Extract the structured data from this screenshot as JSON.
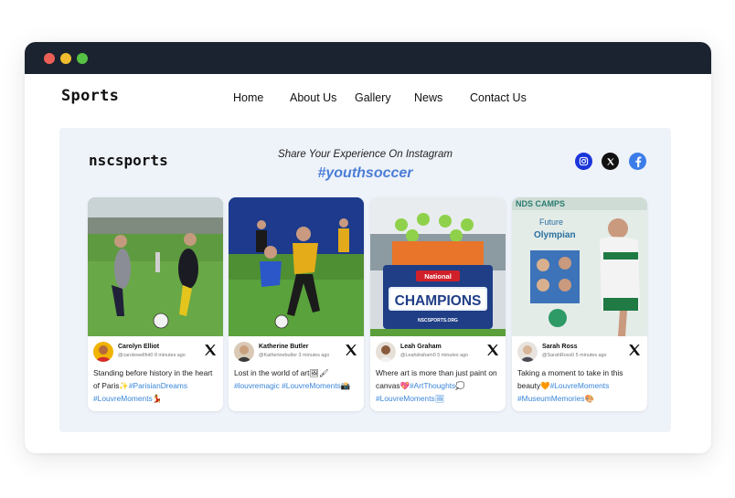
{
  "nav": {
    "brand": "Sports",
    "links": [
      "Home",
      "About Us",
      "Gallery",
      "News",
      "Contact Us"
    ]
  },
  "feed": {
    "logo": "nscsports",
    "subtitle": "Share Your Experience On Instagram",
    "hashtag": "#youthsoccer",
    "social": [
      "instagram-icon",
      "x-icon",
      "facebook-icon"
    ]
  },
  "photo_text": {
    "banner_national": "National",
    "banner_champions": "CHAMPIONS",
    "banner_site": "NSCSPORTS.ORG",
    "camp_top": "NDS CAMPS",
    "camp_future": "Future",
    "camp_olympian": "Olympian"
  },
  "posts": [
    {
      "name": "Carolyn Elliot",
      "handle": "@carolewellfot0",
      "time": "8 minutes ago",
      "text": "Standing before history in the heart of Paris✨",
      "tags": "#ParisianDreams #LouvreMoments💃"
    },
    {
      "name": "Katherine Butler",
      "handle": "@Katherinebutler",
      "time": "3 minutes ago",
      "text": "Lost in the world of art🖼🖌",
      "tags": "#louvremagic #LouvreMoments📸"
    },
    {
      "name": "Leah Graham",
      "handle": "@Leahdraham0",
      "time": "5 minutes ago",
      "text": "Where art is more than just paint on canvas💖",
      "tags": "#ArtThoughts💭 #LouvreMoments🖼"
    },
    {
      "name": "Sarah Ross",
      "handle": "@SarahRoss0",
      "time": "5 minutes ago",
      "text": "Taking a moment to take in this beauty🧡",
      "tags": "#LouvreMoments #MuseumMemories🎨"
    }
  ],
  "colors": {
    "titlebar": "#1b2330",
    "feed_bg": "#eef2f9",
    "hashtag": "#4a7ed6",
    "link": "#3a86d9"
  }
}
